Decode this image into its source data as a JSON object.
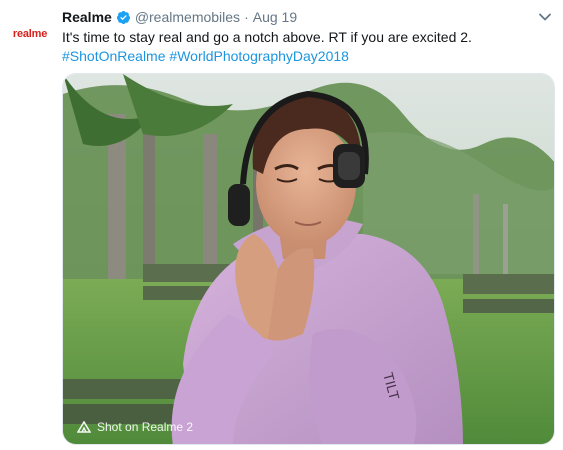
{
  "tweet": {
    "avatar_text": "realme",
    "name": "Realme",
    "handle": "@realmemobiles",
    "separator": "·",
    "date": "Aug 19",
    "text_line1": "It's time to stay real and go a notch above. RT if you are excited 2.",
    "hashtag1": "#ShotOnRealme",
    "hashtag2": "#WorldPhotographyDay2018",
    "photo_watermark": "Shot on Realme 2"
  },
  "colors": {
    "hashtag": "#1b95e0",
    "verified": "#1da1f2",
    "brand": "#d6221d",
    "meta": "#657786"
  },
  "icons": {
    "verified": "verified-badge-icon",
    "caret": "chevron-down-icon",
    "watermark": "camera-ai-icon"
  }
}
